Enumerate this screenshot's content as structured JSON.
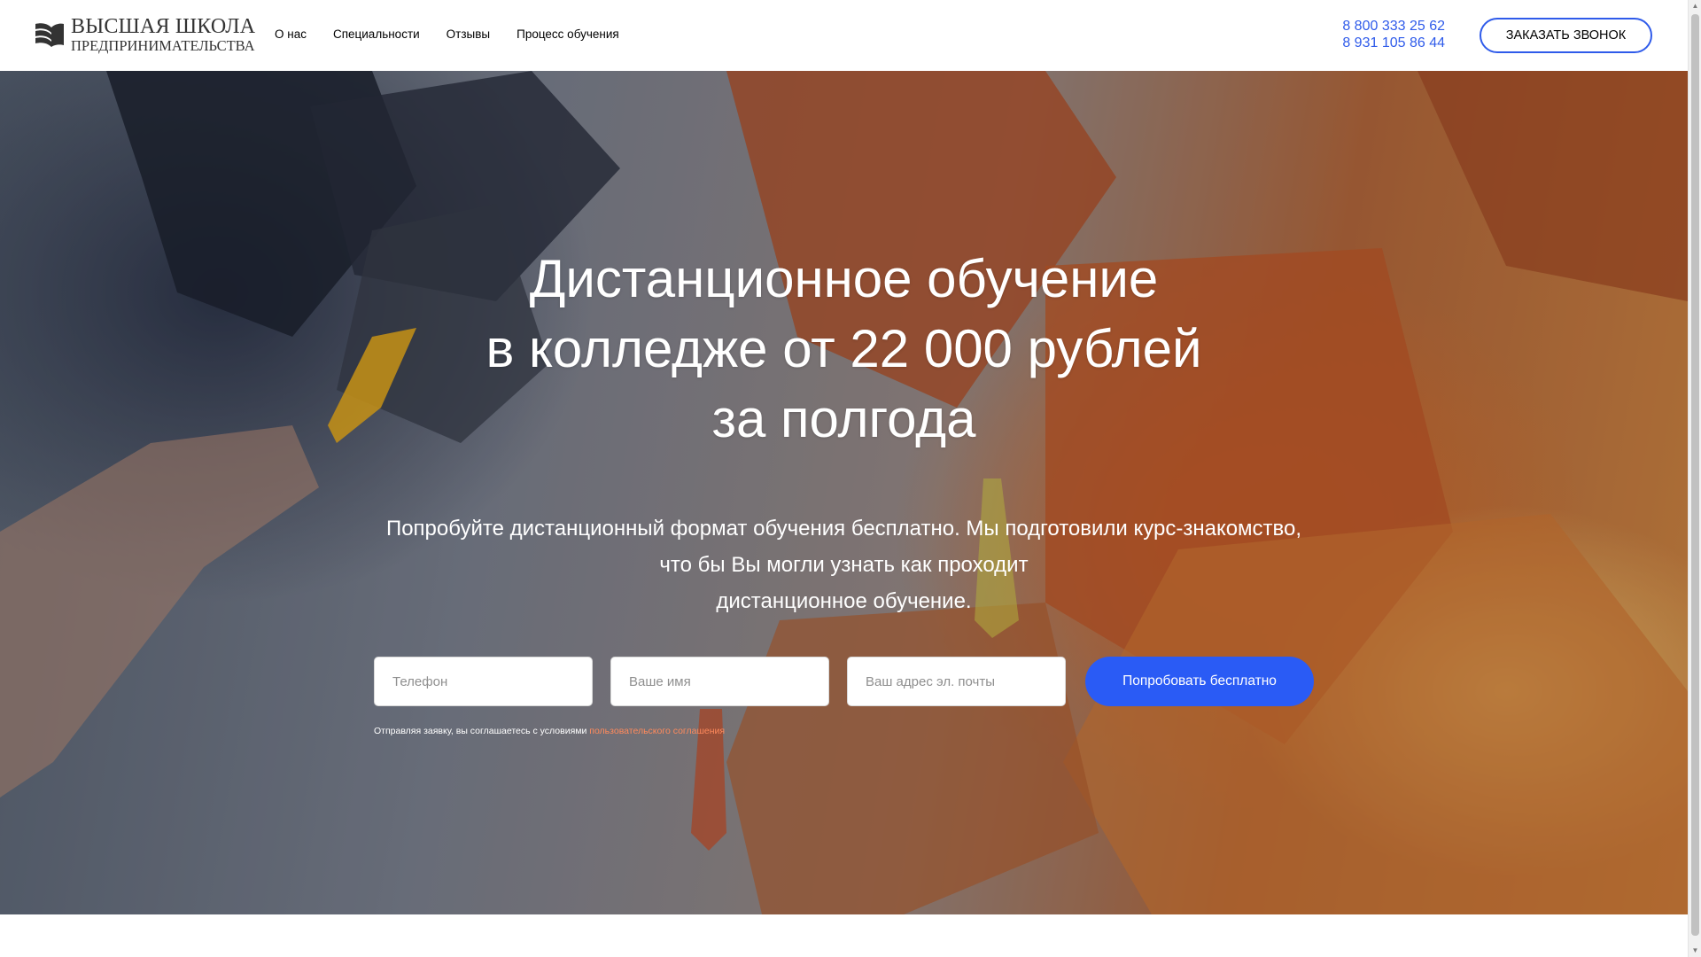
{
  "header": {
    "logo": {
      "line1": "ВЫСШАЯ ШКОЛА",
      "line2": "ПРЕДПРИНИМАТЕЛЬСТВА",
      "icon": "book-pages-icon"
    },
    "nav": [
      {
        "label": "О нас"
      },
      {
        "label": "Специальности"
      },
      {
        "label": "Отзывы"
      },
      {
        "label": "Процесс обучения"
      }
    ],
    "phones": [
      "8 800 333 25 62",
      "8 931 105 86 44"
    ],
    "callback_button": "ЗАКАЗАТЬ ЗВОНОК"
  },
  "hero": {
    "title_lines": [
      "Дистанционное обучение",
      "в колледже от 22 000 рублей",
      "за полгода"
    ],
    "subtitle_lines": [
      "Попробуйте дистанционный формат обучения бесплатно. Мы подготовили курс-знакомство,",
      "что бы Вы могли узнать как проходит",
      "дистанционное обучение."
    ],
    "form": {
      "phone_placeholder": "Телефон",
      "name_placeholder": "Ваше имя",
      "email_placeholder": "Ваш адрес эл. почты",
      "submit_label": "Попробовать бесплатно"
    },
    "consent": {
      "text": "Отправляя заявку, вы соглашаетесь с условиями ",
      "link": "пользовательского соглашения"
    }
  },
  "colors": {
    "accent": "#2a5bf5",
    "phone_link": "#2f5bea",
    "consent_link": "#ff8a5c"
  }
}
